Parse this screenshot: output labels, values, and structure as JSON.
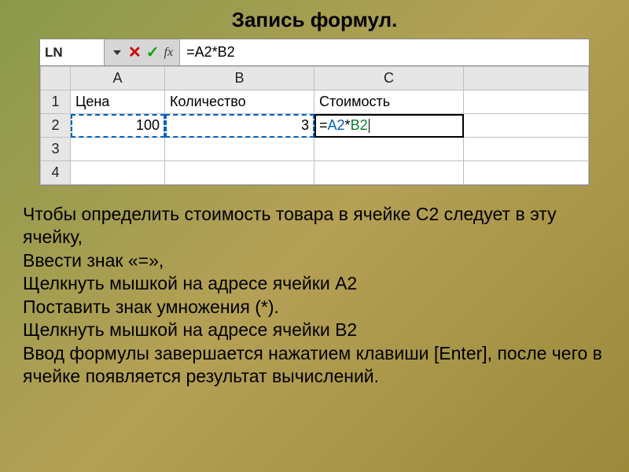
{
  "title": "Запись формул.",
  "excel": {
    "name_box": "LN",
    "formula_text": "=A2*B2",
    "fx_label": "fx",
    "columns": [
      "A",
      "B",
      "C"
    ],
    "rows": [
      "1",
      "2",
      "3",
      "4"
    ],
    "headers": {
      "A1": "Цена",
      "B1": "Количество",
      "C1": "Стоимость"
    },
    "values": {
      "A2": "100",
      "B2": "3"
    },
    "editing": {
      "prefix": "=",
      "ref1": "A2",
      "op": "*",
      "ref2": "B2"
    }
  },
  "body": {
    "p1": "Чтобы определить стоимость товара в ячейке C2 следует в эту ячейку,",
    "p2": "Ввести знак «=»,",
    "p3": "Щелкнуть мышкой на адресе ячейки A2",
    "p4": "Поставить знак умножения (*).",
    "p5": "Щелкнуть мышкой на адресе ячейки B2",
    "p6": "Ввод формулы завершается нажатием клавиши [Enter], после чего в ячейке появляется результат вычислений."
  }
}
